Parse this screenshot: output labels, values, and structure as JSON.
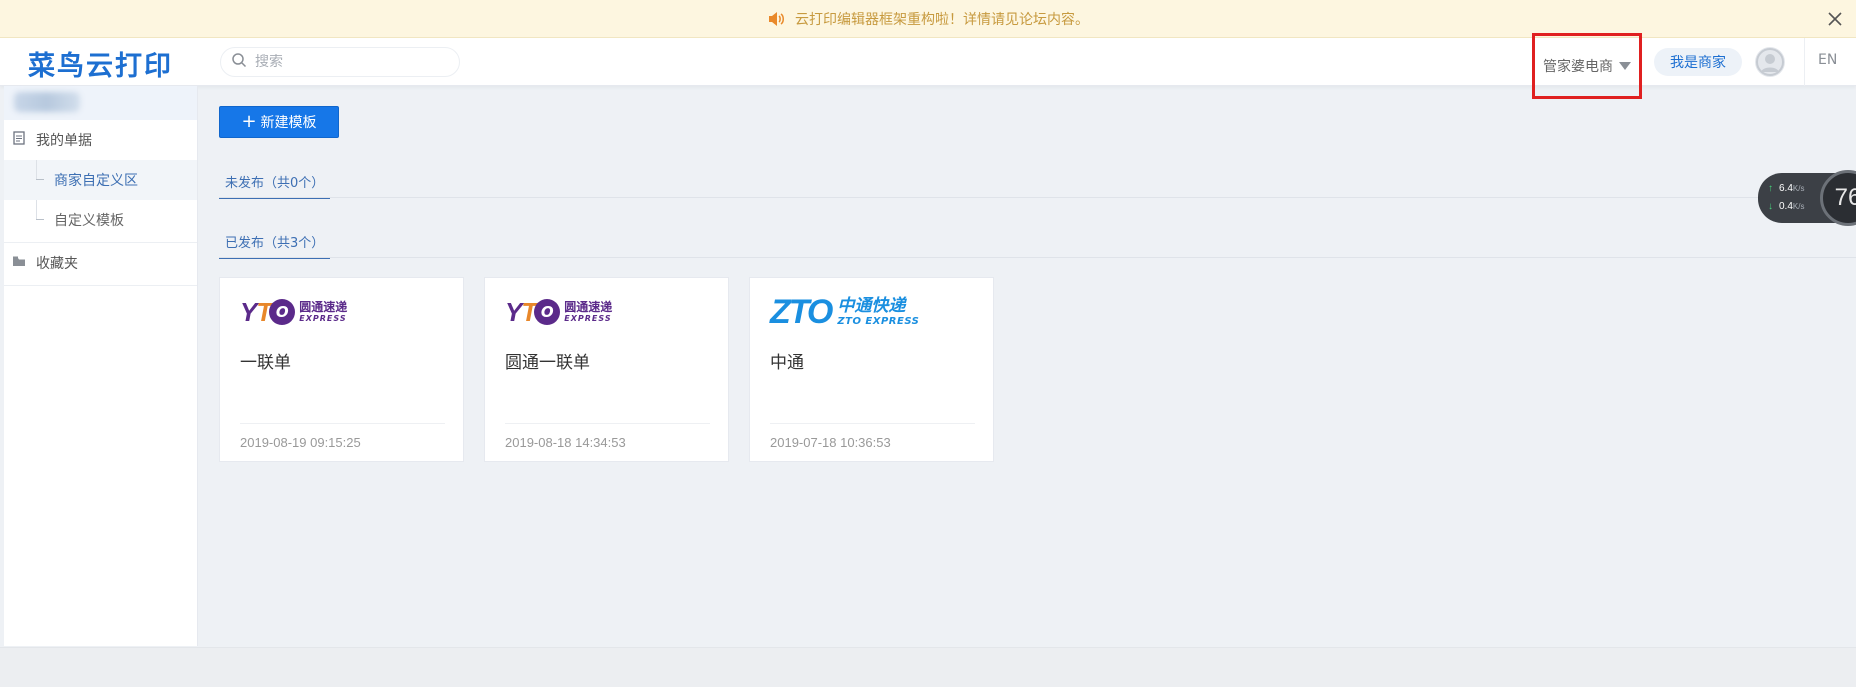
{
  "notice": {
    "text": "云打印编辑器框架重构啦！详情请见论坛内容。"
  },
  "header": {
    "logo": "菜鸟云打印",
    "search_placeholder": "搜索",
    "user_dropdown": "管家婆电商",
    "merchant_button": "我是商家",
    "language": "EN"
  },
  "sidebar": {
    "my_docs": "我的单据",
    "sub_items": [
      {
        "label": "商家自定义区"
      },
      {
        "label": "自定义模板"
      }
    ],
    "favorites": "收藏夹"
  },
  "main": {
    "new_template": "新建模板",
    "unpublished_tab": "未发布（共0个）",
    "published_tab": "已发布（共3个）",
    "cards": [
      {
        "logo": "yto",
        "logo_cn": "圆通速递",
        "logo_en": "EXPRESS",
        "name": "一联单",
        "date": "2019-08-19 09:15:25"
      },
      {
        "logo": "yto",
        "logo_cn": "圆通速递",
        "logo_en": "EXPRESS",
        "name": "圆通一联单",
        "date": "2019-08-18 14:34:53"
      },
      {
        "logo": "zto",
        "logo_cn": "中通快递",
        "logo_en": "ZTO EXPRESS",
        "name": "中通",
        "date": "2019-07-18 10:36:53"
      }
    ]
  },
  "speed_widget": {
    "up": "6.4",
    "down": "0.4",
    "unit": "K/s",
    "value": "76"
  },
  "colors": {
    "primary": "#1677e8",
    "brand": "#1d6fd1",
    "highlight_box": "#e02020"
  }
}
